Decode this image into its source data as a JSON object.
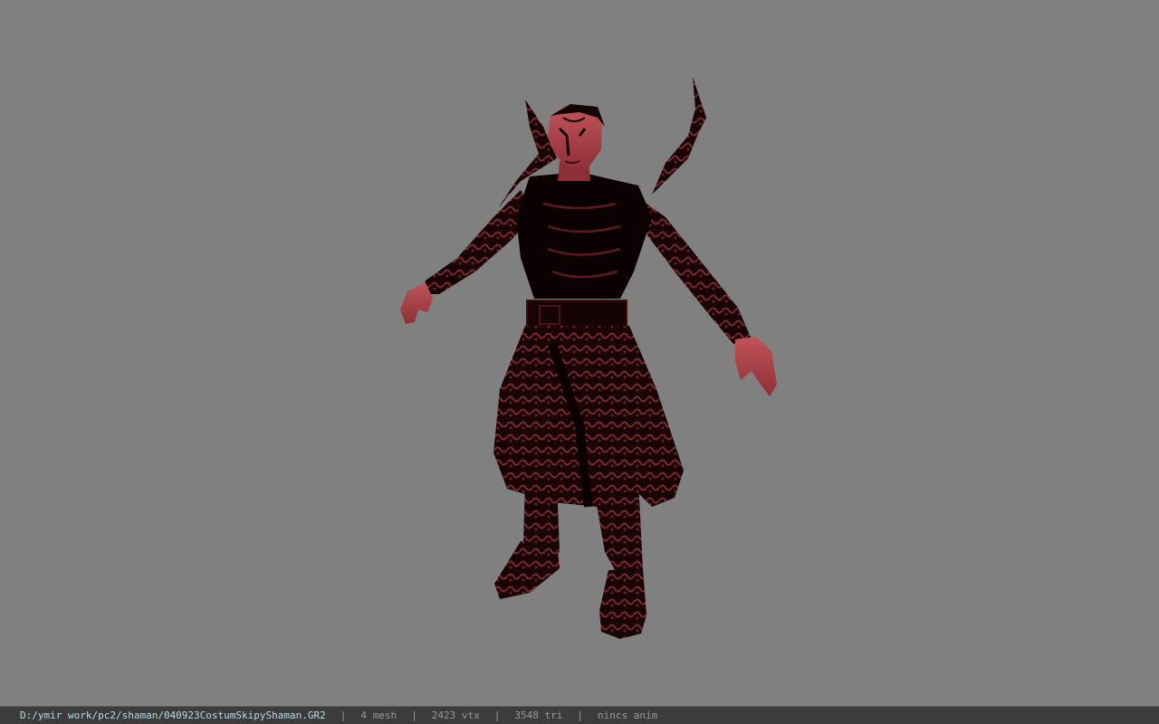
{
  "viewer": {
    "background_color": "#808080",
    "model_name": "shaman character (costume skipy)"
  },
  "status_bar": {
    "file_path": "D:/ymir work/pc2/shaman/040923CostumSkipyShaman.GR2",
    "mesh_count": "4 mesh",
    "vertex_count": "2423 vtx",
    "triangle_count": "3548 tri",
    "animation": "nincs anim",
    "separator": "|",
    "colors": {
      "background": "#3c3c3c",
      "path_text": "#b8dbe6",
      "stat_text": "#9a9a9a"
    }
  }
}
